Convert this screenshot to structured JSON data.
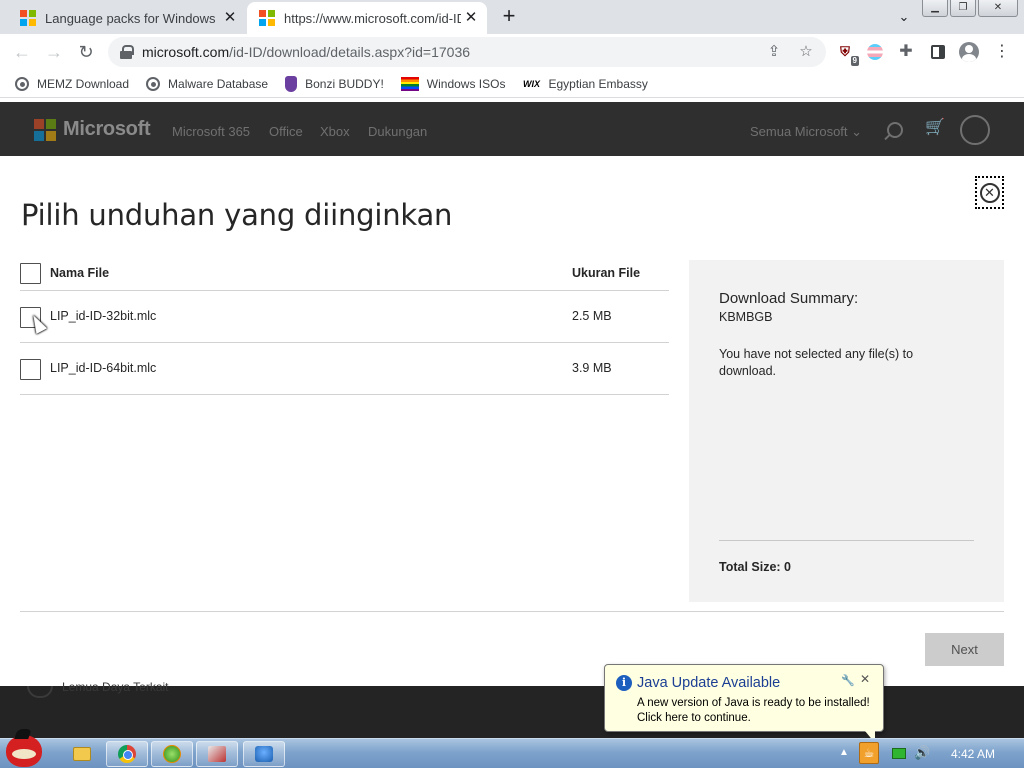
{
  "browser": {
    "tabs": [
      {
        "title": "Language packs for Windows"
      },
      {
        "title": "https://www.microsoft.com/id-ID"
      }
    ],
    "url_host": "microsoft.com",
    "url_path": "/id-ID/download/details.aspx?id=17036",
    "extension_badge": "9",
    "bookmarks": [
      {
        "label": "MEMZ Download",
        "icon": "globe-icon"
      },
      {
        "label": "Malware Database",
        "icon": "globe-icon"
      },
      {
        "label": "Bonzi BUDDY!",
        "icon": "bonzi-icon"
      },
      {
        "label": "Windows ISOs",
        "icon": "rainbow-flag-icon"
      },
      {
        "label": "Egyptian Embassy",
        "icon": "wix-icon"
      }
    ]
  },
  "ms_header": {
    "brand": "Microsoft",
    "nav": [
      "Microsoft 365",
      "Office",
      "Xbox",
      "Dukungan"
    ],
    "all_microsoft": "Semua Microsoft ⌄"
  },
  "dialog": {
    "title": "Pilih unduhan yang diinginkan",
    "columns": {
      "name": "Nama File",
      "size": "Ukuran File"
    },
    "files": [
      {
        "name": "LIP_id-ID-32bit.mlc",
        "size": "2.5 MB",
        "checked": false
      },
      {
        "name": "LIP_id-ID-64bit.mlc",
        "size": "3.9 MB",
        "checked": false
      }
    ],
    "summary": {
      "title": "Download Summary:",
      "code": "KBMBGB",
      "message": "You have not selected any file(s) to download.",
      "total": "Total Size: 0"
    },
    "next_label": "Next"
  },
  "page_bottom_faint": "Lemua Daya Terkait",
  "java_balloon": {
    "title": "Java Update Available",
    "line1": "A new version of Java is ready to be installed!",
    "line2": "Click here to continue."
  },
  "taskbar": {
    "clock": "4:42 AM"
  },
  "colors": {
    "ms_header_bg": "#2f2f2f",
    "summary_bg": "#f2f2f2",
    "next_button_bg": "#cccccc",
    "balloon_bg": "#ffffe1",
    "balloon_title": "#1c3f94"
  }
}
